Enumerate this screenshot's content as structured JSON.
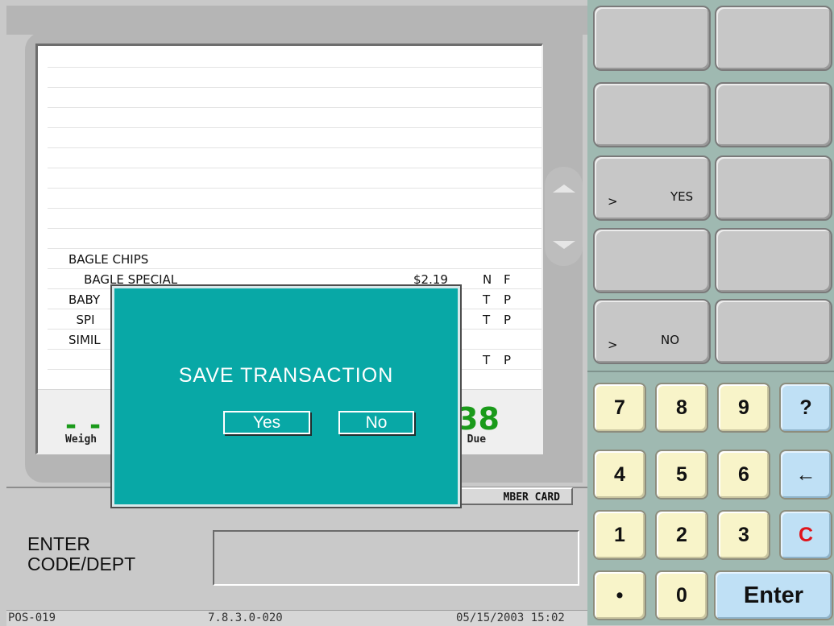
{
  "receipt": {
    "items": [
      {
        "desc": "BAGLE CHIPS",
        "amount": "",
        "flag1": "",
        "flag2": ""
      },
      {
        "desc": "    BAGLE SPECIAL",
        "amount": "$2.19",
        "flag1": "N",
        "flag2": "F"
      },
      {
        "desc": "BABY",
        "amount": "",
        "flag1": "T",
        "flag2": "P"
      },
      {
        "desc": "  SPI",
        "amount": "",
        "flag1": "T",
        "flag2": "P"
      },
      {
        "desc": "SIMIL",
        "amount": "",
        "flag1": "",
        "flag2": ""
      },
      {
        "desc": "",
        "amount": "",
        "flag1": "T",
        "flag2": "P"
      }
    ]
  },
  "totals": {
    "weight_dashes": "- - -",
    "weight_label": "Weigh",
    "due_amount": "38",
    "due_label": "e Due"
  },
  "member_card_label": "MBER CARD",
  "prompt": {
    "line1": "ENTER",
    "line2": "CODE/DEPT"
  },
  "status": {
    "terminal": "POS-019",
    "version": "7.8.3.0-020",
    "datetime": "05/15/2003 15:02"
  },
  "function_keys": [
    {
      "prefix": "",
      "label": ""
    },
    {
      "prefix": "",
      "label": ""
    },
    {
      "prefix": "",
      "label": ""
    },
    {
      "prefix": "",
      "label": ""
    },
    {
      "prefix": ">",
      "label": "YES"
    },
    {
      "prefix": "",
      "label": ""
    },
    {
      "prefix": "",
      "label": ""
    },
    {
      "prefix": "",
      "label": ""
    },
    {
      "prefix": ">",
      "label": "NO"
    },
    {
      "prefix": "",
      "label": ""
    }
  ],
  "keypad": {
    "k7": "7",
    "k8": "8",
    "k9": "9",
    "help": "?",
    "k4": "4",
    "k5": "5",
    "k6": "6",
    "back": "←",
    "k1": "1",
    "k2": "2",
    "k3": "3",
    "clear": "C",
    "dot": "•",
    "k0": "0",
    "enter": "Enter"
  },
  "dialog": {
    "title": "SAVE TRANSACTION",
    "yes": "Yes",
    "no": "No"
  },
  "colors": {
    "dialog_bg": "#08a8a6",
    "amount_green": "#1a9a1a",
    "clear_red": "#e0141a"
  }
}
